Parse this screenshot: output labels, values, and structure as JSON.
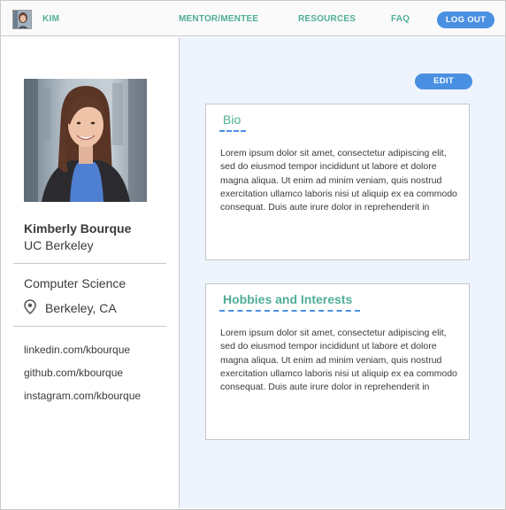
{
  "nav": {
    "user_label": "KIM",
    "links": [
      {
        "label": "MENTOR/MENTEE"
      },
      {
        "label": "RESOURCES"
      },
      {
        "label": "FAQ"
      }
    ],
    "logout_label": "LOG OUT"
  },
  "profile": {
    "name": "Kimberly Bourque",
    "school": "UC Berkeley",
    "major": "Computer Science",
    "location": "Berkeley, CA",
    "location_icon": "map-pin-icon",
    "links": [
      "linkedin.com/kbourque",
      "github.com/kbourque",
      "instagram.com/kbourque"
    ]
  },
  "main": {
    "edit_label": "EDIT",
    "bio": {
      "title": "Bio",
      "text": "Lorem ipsum dolor sit amet, consectetur adipiscing elit, sed do eiusmod tempor incididunt ut labore et dolore magna aliqua. Ut enim ad minim veniam, quis nostrud exercitation ullamco laboris nisi ut aliquip ex ea commodo consequat. Duis aute irure dolor in reprehenderit in"
    },
    "hobbies": {
      "title": "Hobbies and Interests",
      "text": "Lorem ipsum dolor sit amet, consectetur adipiscing elit, sed do eiusmod tempor incididunt ut labore et dolore magna aliqua. Ut enim ad minim veniam, quis nostrud exercitation ullamco laboris nisi ut aliquip ex ea commodo consequat. Duis aute irure dolor in reprehenderit in"
    }
  },
  "colors": {
    "accent_green": "#4fae96",
    "button_blue": "#4a90e2",
    "main_background": "#eef4fd",
    "border": "#c9c9c9"
  }
}
